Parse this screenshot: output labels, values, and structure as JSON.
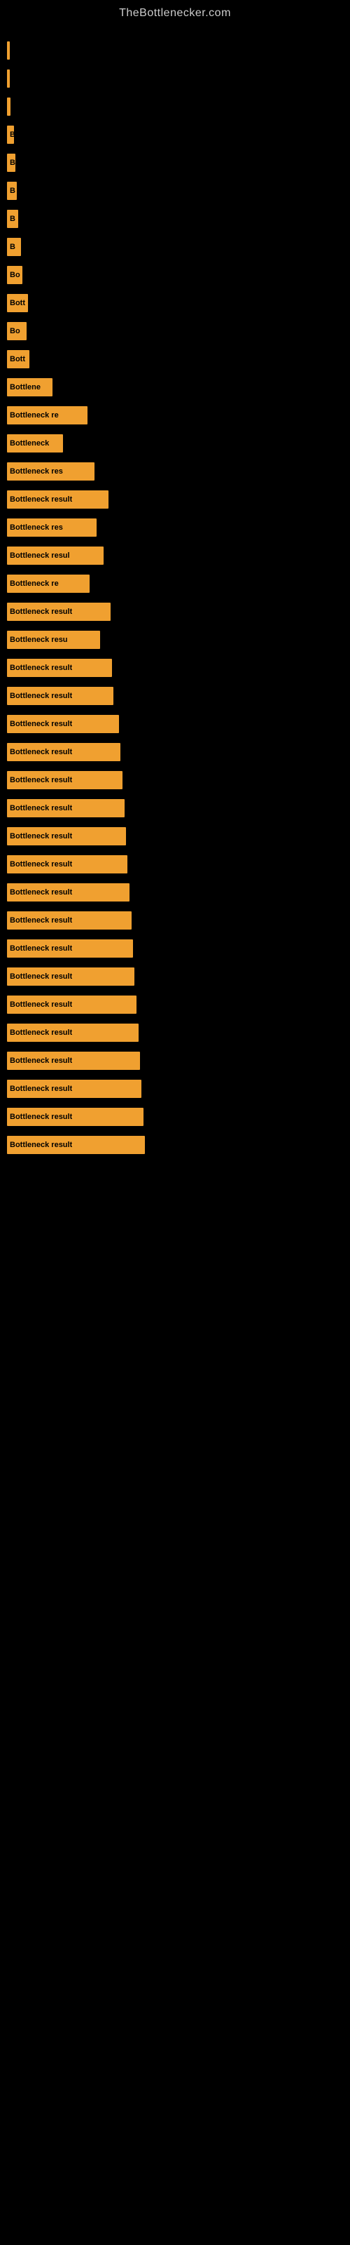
{
  "header": {
    "title": "TheBottlenecker.com"
  },
  "bars": [
    {
      "label": "",
      "width": 3
    },
    {
      "label": "",
      "width": 4
    },
    {
      "label": "",
      "width": 5
    },
    {
      "label": "B",
      "width": 10
    },
    {
      "label": "B",
      "width": 12
    },
    {
      "label": "B",
      "width": 14
    },
    {
      "label": "B",
      "width": 16
    },
    {
      "label": "B",
      "width": 20
    },
    {
      "label": "Bo",
      "width": 22
    },
    {
      "label": "Bott",
      "width": 30
    },
    {
      "label": "Bo",
      "width": 28
    },
    {
      "label": "Bott",
      "width": 32
    },
    {
      "label": "Bottlene",
      "width": 65
    },
    {
      "label": "Bottleneck re",
      "width": 115
    },
    {
      "label": "Bottleneck",
      "width": 80
    },
    {
      "label": "Bottleneck res",
      "width": 125
    },
    {
      "label": "Bottleneck result",
      "width": 145
    },
    {
      "label": "Bottleneck res",
      "width": 128
    },
    {
      "label": "Bottleneck resul",
      "width": 138
    },
    {
      "label": "Bottleneck re",
      "width": 118
    },
    {
      "label": "Bottleneck result",
      "width": 148
    },
    {
      "label": "Bottleneck resu",
      "width": 133
    },
    {
      "label": "Bottleneck result",
      "width": 150
    },
    {
      "label": "Bottleneck result",
      "width": 152
    },
    {
      "label": "Bottleneck result",
      "width": 160
    },
    {
      "label": "Bottleneck result",
      "width": 162
    },
    {
      "label": "Bottleneck result",
      "width": 165
    },
    {
      "label": "Bottleneck result",
      "width": 168
    },
    {
      "label": "Bottleneck result",
      "width": 170
    },
    {
      "label": "Bottleneck result",
      "width": 172
    },
    {
      "label": "Bottleneck result",
      "width": 175
    },
    {
      "label": "Bottleneck result",
      "width": 178
    },
    {
      "label": "Bottleneck result",
      "width": 180
    },
    {
      "label": "Bottleneck result",
      "width": 182
    },
    {
      "label": "Bottleneck result",
      "width": 185
    },
    {
      "label": "Bottleneck result",
      "width": 188
    },
    {
      "label": "Bottleneck result",
      "width": 190
    },
    {
      "label": "Bottleneck result",
      "width": 192
    },
    {
      "label": "Bottleneck result",
      "width": 195
    },
    {
      "label": "Bottleneck result",
      "width": 197
    }
  ]
}
